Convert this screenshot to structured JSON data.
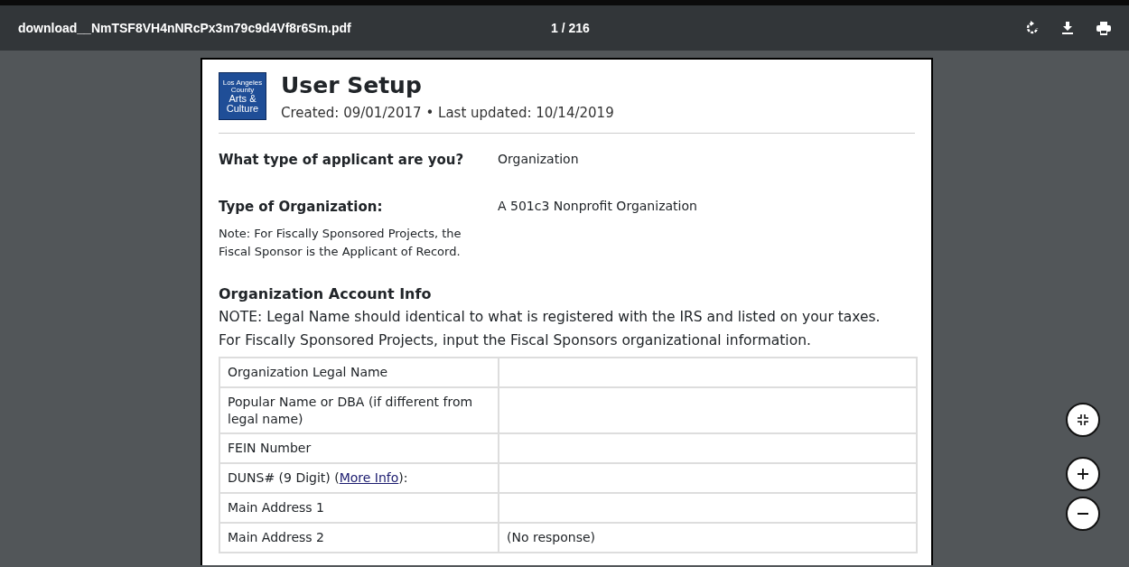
{
  "toolbar": {
    "filename": "download__NmTSF8VH4nNRcPx3m79c9d4Vf8r6Sm.pdf",
    "page_counter": "1 / 216"
  },
  "document": {
    "logo_lines": [
      "Los Angeles",
      "County",
      "Arts &",
      "Culture"
    ],
    "title": "User Setup",
    "meta": "Created: 09/01/2017 • Last updated: 10/14/2019",
    "answers": [
      {
        "question": "What type of applicant are you?",
        "answer": "Organization"
      },
      {
        "question": "Type of Organization:",
        "answer": "A 501c3 Nonprofit Organization",
        "note": "Note: For Fiscally Sponsored Projects, the Fiscal Sponsor is the Applicant of Record."
      }
    ],
    "section": {
      "heading": "Organization Account Info",
      "notes": [
        "NOTE: Legal Name should identical to what is registered with the IRS and listed on your taxes.",
        "For Fiscally Sponsored Projects, input the Fiscal Sponsors organizational information."
      ]
    },
    "rows": [
      {
        "label": "Organization Legal Name"
      },
      {
        "label": "Popular Name or DBA (if different from legal name)"
      },
      {
        "label": "FEIN Number"
      },
      {
        "label": "DUNS# (9 Digit) (",
        "link": "More Info",
        "label_end": "):"
      },
      {
        "label": "Main Address 1"
      },
      {
        "label": "Main Address 2",
        "value": "(No response)"
      }
    ]
  }
}
